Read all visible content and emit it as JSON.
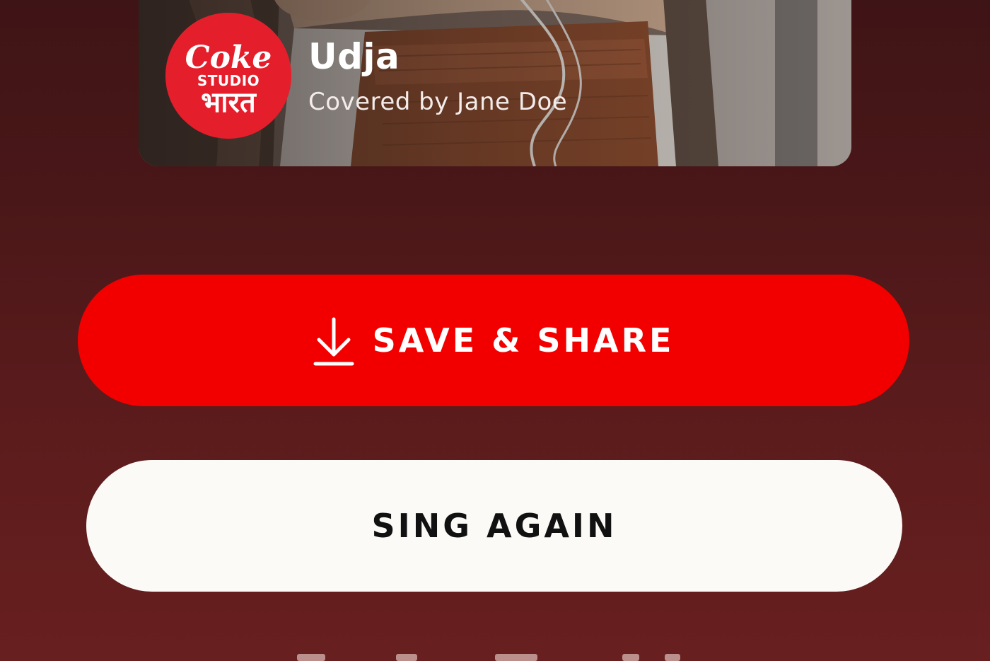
{
  "video": {
    "thumbnail_icon": "video-thumbnail-person",
    "song_title": "Udja",
    "covered_by": "Covered by Jane Doe"
  },
  "brand": {
    "logo_icon": "coke-studio-bharat-logo",
    "logo_text_line1": "Coke",
    "logo_text_line2": "STUDIO",
    "logo_text_line3": "भारत",
    "color": "#e41e2b"
  },
  "actions": {
    "save_share_label": "SAVE & SHARE",
    "save_share_icon": "download-icon",
    "save_share_color": "#f20000",
    "sing_again_label": "SING AGAIN",
    "sing_again_color": "#fbfaf7"
  },
  "theme": {
    "background": "#4a1718"
  }
}
